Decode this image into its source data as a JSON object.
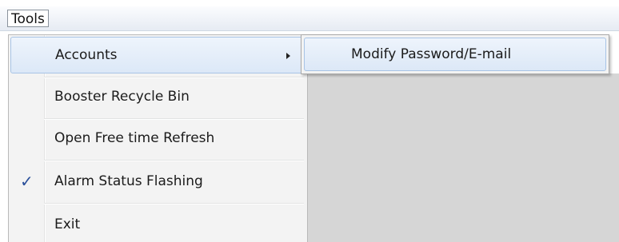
{
  "menubar": {
    "tools_label": "Tools"
  },
  "dropdown": {
    "items": [
      {
        "label": "Accounts",
        "has_submenu": true,
        "highlighted": true
      },
      {
        "label": "Booster Recycle Bin"
      },
      {
        "label": "Open Free time Refresh"
      },
      {
        "label": "Alarm Status Flashing",
        "checked": true
      },
      {
        "label": "Exit"
      }
    ],
    "check_glyph": "✓"
  },
  "submenu": {
    "items": [
      {
        "label": "Modify Password/E-mail",
        "highlighted": true
      }
    ]
  },
  "icons": {
    "submenu_arrow": "chevron-right-icon",
    "check": "check-icon"
  },
  "colors": {
    "highlight_border": "#a8c4e6",
    "menu_background": "#f3f3f3",
    "app_area": "#d6d6d6",
    "check_color": "#2a4f9a"
  }
}
